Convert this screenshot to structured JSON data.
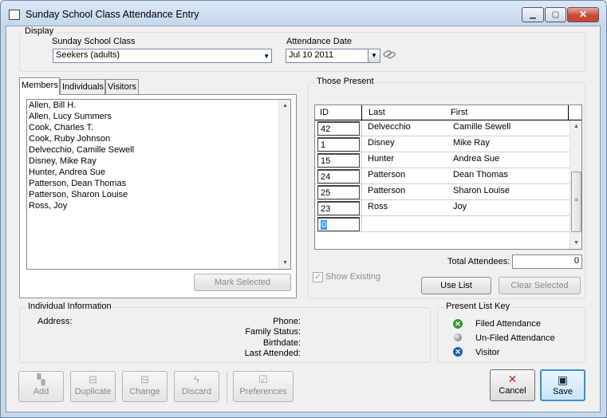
{
  "window": {
    "title": "Sunday School Class Attendance Entry",
    "min": "▁",
    "max": "▢",
    "close": "✕"
  },
  "display": {
    "group_title": "Display",
    "class_label": "Sunday School Class",
    "class_value": "Seekers (adults)",
    "date_label": "Attendance Date",
    "date_value": "Jul 10 2011"
  },
  "tabs": [
    "Members",
    "Individuals",
    "Visitors"
  ],
  "members": [
    "Allen, Bill H.",
    "Allen, Lucy Summers",
    "Cook, Charles T.",
    "Cook, Ruby Johnson",
    "Delvecchio, Camille Sewell",
    "Disney, Mike Ray",
    "Hunter, Andrea Sue",
    "Patterson, Dean Thomas",
    "Patterson, Sharon Louise",
    "Ross, Joy"
  ],
  "mark_selected": "Mark Selected",
  "present": {
    "group_title": "Those Present",
    "columns": {
      "id": "ID",
      "last": "Last",
      "first": "First"
    },
    "rows": [
      {
        "id": "42",
        "last": "Delvecchio",
        "first": "Camille Sewell"
      },
      {
        "id": "1",
        "last": "Disney",
        "first": "Mike Ray"
      },
      {
        "id": "15",
        "last": "Hunter",
        "first": "Andrea Sue"
      },
      {
        "id": "24",
        "last": "Patterson",
        "first": "Dean Thomas"
      },
      {
        "id": "25",
        "last": "Patterson",
        "first": "Sharon Louise"
      },
      {
        "id": "23",
        "last": "Ross",
        "first": "Joy"
      }
    ],
    "new_row_id": "0",
    "total_label": "Total Attendees:",
    "total_value": "0",
    "show_existing": "Show Existing",
    "use_list": "Use List",
    "clear_selected": "Clear Selected"
  },
  "individual": {
    "group_title": "Individual Information",
    "address": "Address:",
    "phone": "Phone:",
    "family_status": "Family Status:",
    "birthdate": "Birthdate:",
    "last_attended": "Last Attended:"
  },
  "key": {
    "group_title": "Present List Key",
    "items": [
      {
        "label": "Filed Attendance",
        "color": "#2e9b2e"
      },
      {
        "label": "Un-Filed Attendance",
        "color": "#8c8c8c"
      },
      {
        "label": "Visitor",
        "color": "#1d5fb4"
      }
    ]
  },
  "toolbar": {
    "add": "Add",
    "duplicate": "Duplicate",
    "change": "Change",
    "discard": "Discard",
    "preferences": "Preferences",
    "cancel": "Cancel",
    "save": "Save"
  }
}
